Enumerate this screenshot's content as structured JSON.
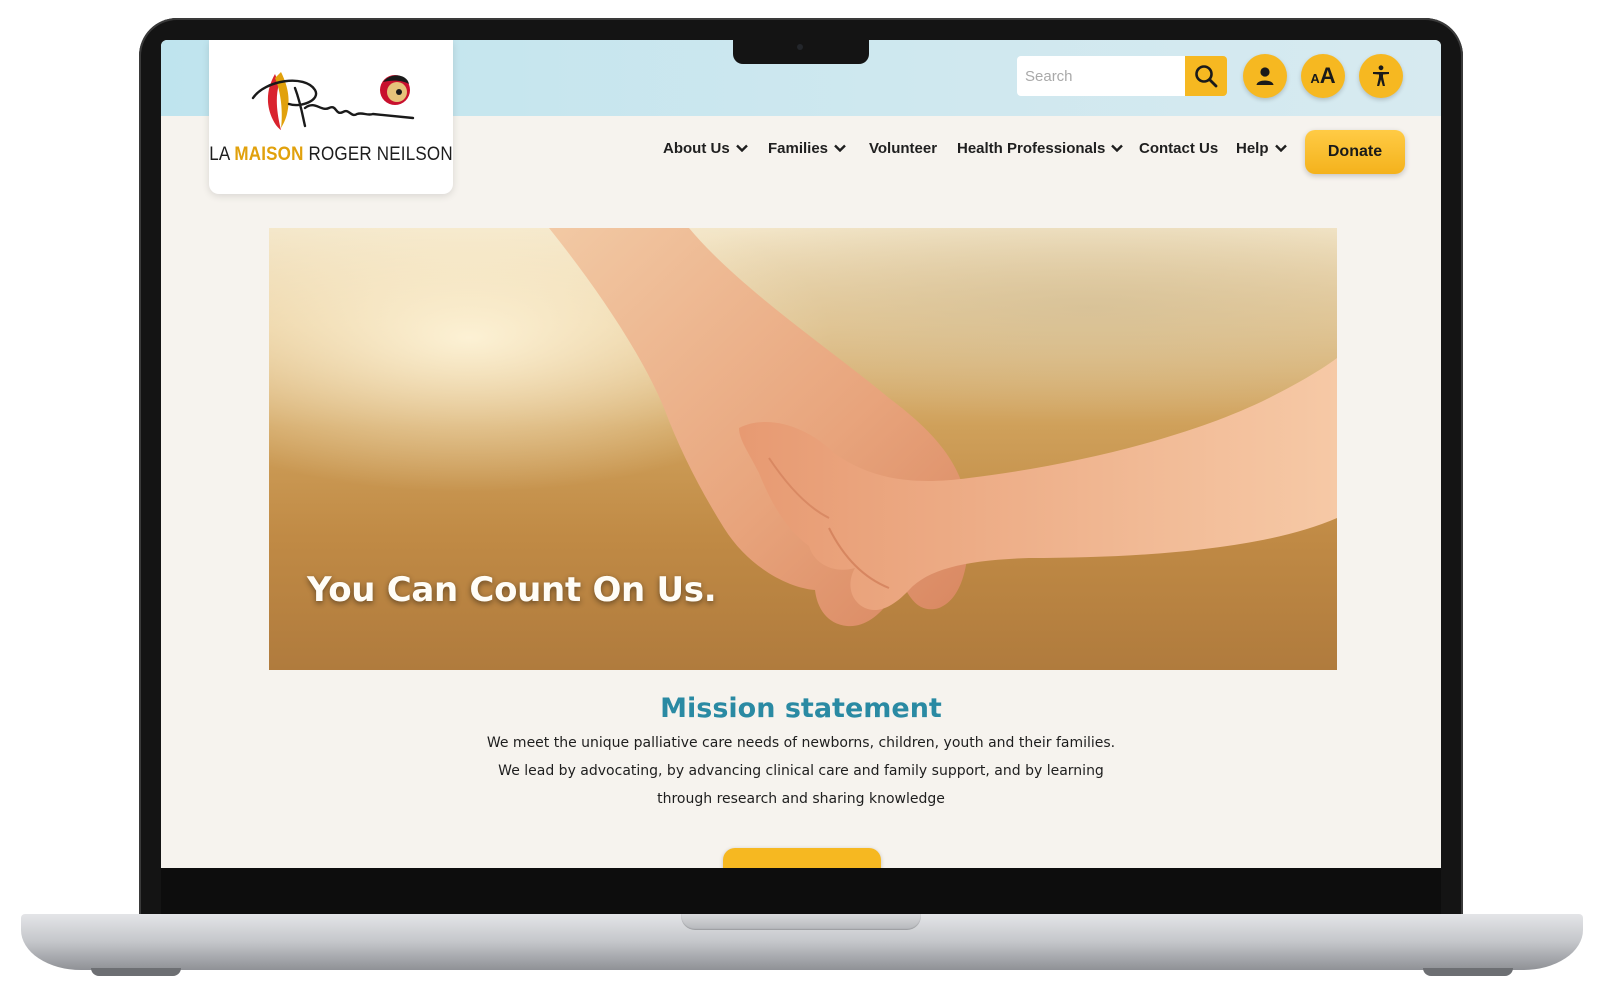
{
  "brand": {
    "logo_line_prefix": "LA ",
    "logo_line_accent": "MAISON",
    "logo_line_suffix": " ROGER NEILSON",
    "accent_color": "#f6b821",
    "heading_color": "#2a8aa3"
  },
  "search": {
    "placeholder": "Search",
    "icon": "search-icon"
  },
  "utility_buttons": [
    {
      "icon": "user-icon"
    },
    {
      "icon": "text-size-icon",
      "label_small": "A",
      "label_big": "A"
    },
    {
      "icon": "accessibility-icon"
    }
  ],
  "nav": {
    "items": [
      {
        "label": "About Us",
        "has_dropdown": true
      },
      {
        "label": "Families",
        "has_dropdown": true
      },
      {
        "label": "Volunteer",
        "has_dropdown": false
      },
      {
        "label": "Health Professionals",
        "has_dropdown": true
      },
      {
        "label": "Contact Us",
        "has_dropdown": false
      },
      {
        "label": "Help",
        "has_dropdown": true
      }
    ],
    "donate_label": "Donate"
  },
  "hero": {
    "heading": "You Can Count On Us."
  },
  "mission": {
    "title": "Mission statement",
    "lines": [
      "We meet the unique palliative care needs of newborns, children, youth and their families.",
      "We lead by advocating, by advancing clinical care and family support, and by learning",
      "through research and sharing knowledge"
    ]
  }
}
